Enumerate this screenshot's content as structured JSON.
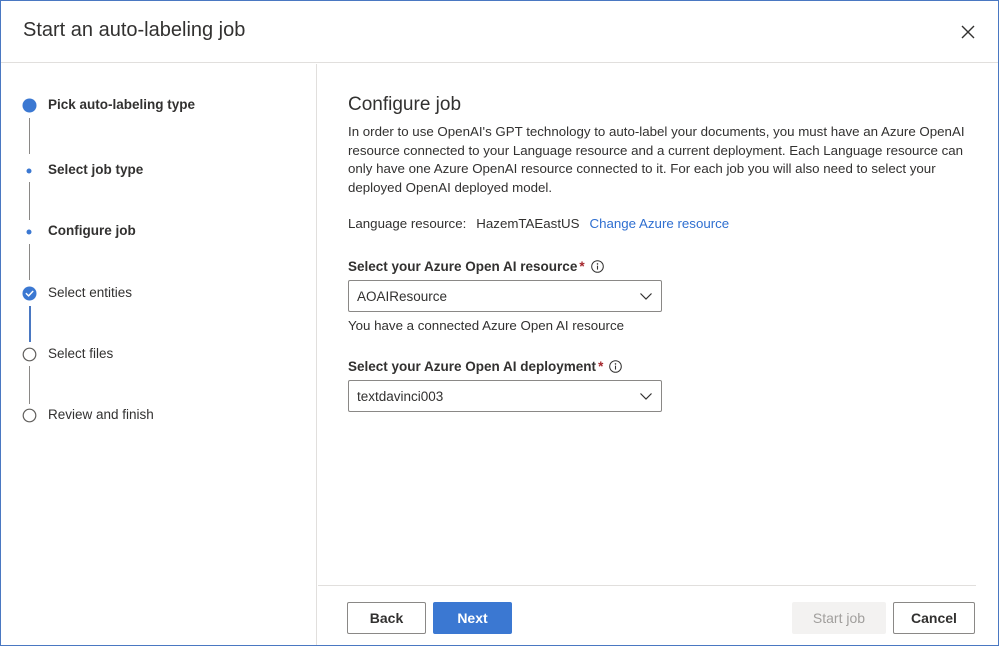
{
  "dialog": {
    "title": "Start an auto-labeling job",
    "close_icon": "close-icon"
  },
  "steps": [
    {
      "label": "Pick auto-labeling type",
      "state": "current"
    },
    {
      "label": "Select job type",
      "state": "active-substep"
    },
    {
      "label": "Configure job",
      "state": "active-substep"
    },
    {
      "label": "Select entities",
      "state": "completed"
    },
    {
      "label": "Select files",
      "state": "pending"
    },
    {
      "label": "Review and finish",
      "state": "pending"
    }
  ],
  "main": {
    "title": "Configure job",
    "description": "In order to use OpenAI's GPT technology to auto-label your documents, you must have an Azure OpenAI resource connected to your Language resource and a current deployment. Each Language resource can only have one Azure OpenAI resource connected to it. For each job you will also need to select your deployed OpenAI deployed model.",
    "language_resource_label": "Language resource:",
    "language_resource_value": "HazemTAEastUS",
    "change_resource_link": "Change Azure resource",
    "resource_field": {
      "label": "Select your Azure Open AI resource",
      "required_mark": "*",
      "value": "AOAIResource",
      "helper": "You have a connected Azure Open AI resource"
    },
    "deployment_field": {
      "label": "Select your Azure Open AI deployment",
      "required_mark": "*",
      "value": "textdavinci003"
    }
  },
  "footer": {
    "back_label": "Back",
    "next_label": "Next",
    "start_label": "Start job",
    "cancel_label": "Cancel"
  },
  "colors": {
    "accent": "#3b78d2",
    "link": "#2f6fd0",
    "required": "#a4262c",
    "border": "#8a8886"
  }
}
